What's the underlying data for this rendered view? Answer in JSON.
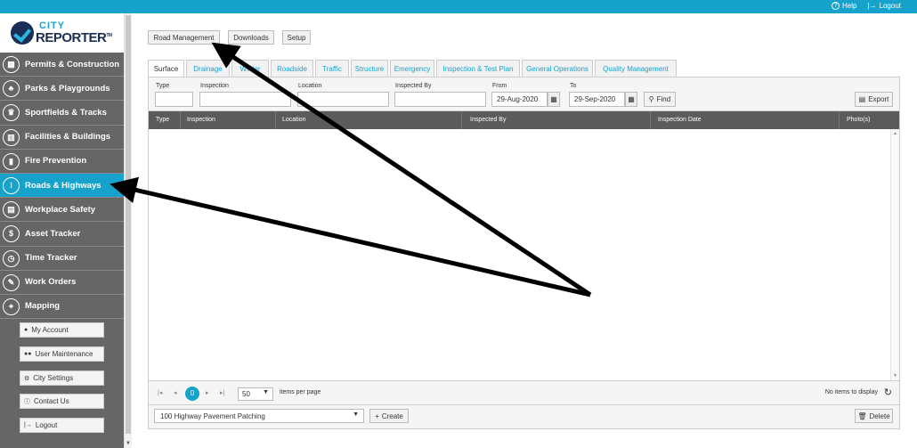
{
  "topbar": {
    "help": "Help",
    "logout": "Logout"
  },
  "logo": {
    "city": "CITY",
    "reporter": "REPORTER",
    "tm": "TM"
  },
  "sidebar": {
    "items": [
      {
        "label": "Permits & Construction",
        "icon": "building-icon"
      },
      {
        "label": "Parks & Playgrounds",
        "icon": "tree-icon"
      },
      {
        "label": "Sportfields & Tracks",
        "icon": "trophy-icon"
      },
      {
        "label": "Facilities & Buildings",
        "icon": "facility-icon"
      },
      {
        "label": "Fire Prevention",
        "icon": "fire-extinguisher-icon"
      },
      {
        "label": "Roads & Highways",
        "icon": "traffic-light-icon"
      },
      {
        "label": "Workplace Safety",
        "icon": "safety-icon"
      },
      {
        "label": "Asset Tracker",
        "icon": "asset-icon"
      },
      {
        "label": "Time Tracker",
        "icon": "clock-icon"
      },
      {
        "label": "Work Orders",
        "icon": "work-order-icon"
      },
      {
        "label": "Mapping",
        "icon": "map-icon"
      }
    ],
    "active_index": 5,
    "account": [
      {
        "label": "My Account",
        "icon": "user-icon"
      },
      {
        "label": "User Maintenance",
        "icon": "users-icon"
      },
      {
        "label": "City Settings",
        "icon": "gear-icon"
      },
      {
        "label": "Contact Us",
        "icon": "info-icon"
      },
      {
        "label": "Logout",
        "icon": "logout-icon"
      }
    ]
  },
  "toolbar": {
    "road_management": "Road Management",
    "downloads": "Downloads",
    "setup": "Setup"
  },
  "tabs": [
    "Surface",
    "Drainage",
    "Winter",
    "Roadside",
    "Traffic",
    "Structure",
    "Emergency",
    "Inspection & Test Plan",
    "General Operations",
    "Quality Management"
  ],
  "active_tab": "Surface",
  "filters": {
    "type_label": "Type",
    "inspection_label": "Inspection",
    "location_label": "Location",
    "inspected_by_label": "Inspected By",
    "from_label": "From",
    "from_value": "29-Aug-2020",
    "to_label": "To",
    "to_value": "29-Sep-2020",
    "find": "Find",
    "export": "Export"
  },
  "grid": {
    "columns": [
      "Type",
      "Inspection",
      "Location",
      "Inspected By",
      "Inspection Date",
      "Photo(s)"
    ],
    "rows": []
  },
  "pager": {
    "current_page": "0",
    "page_size": "50",
    "items_per_page": "items per page",
    "info": "No items to display"
  },
  "footer": {
    "selected_item": "100 Highway Pavement Patching",
    "create": "Create",
    "delete": "Delete"
  },
  "colors": {
    "accent": "#17a2cc",
    "sidebar": "#666666",
    "header": "#5b5b5b"
  }
}
